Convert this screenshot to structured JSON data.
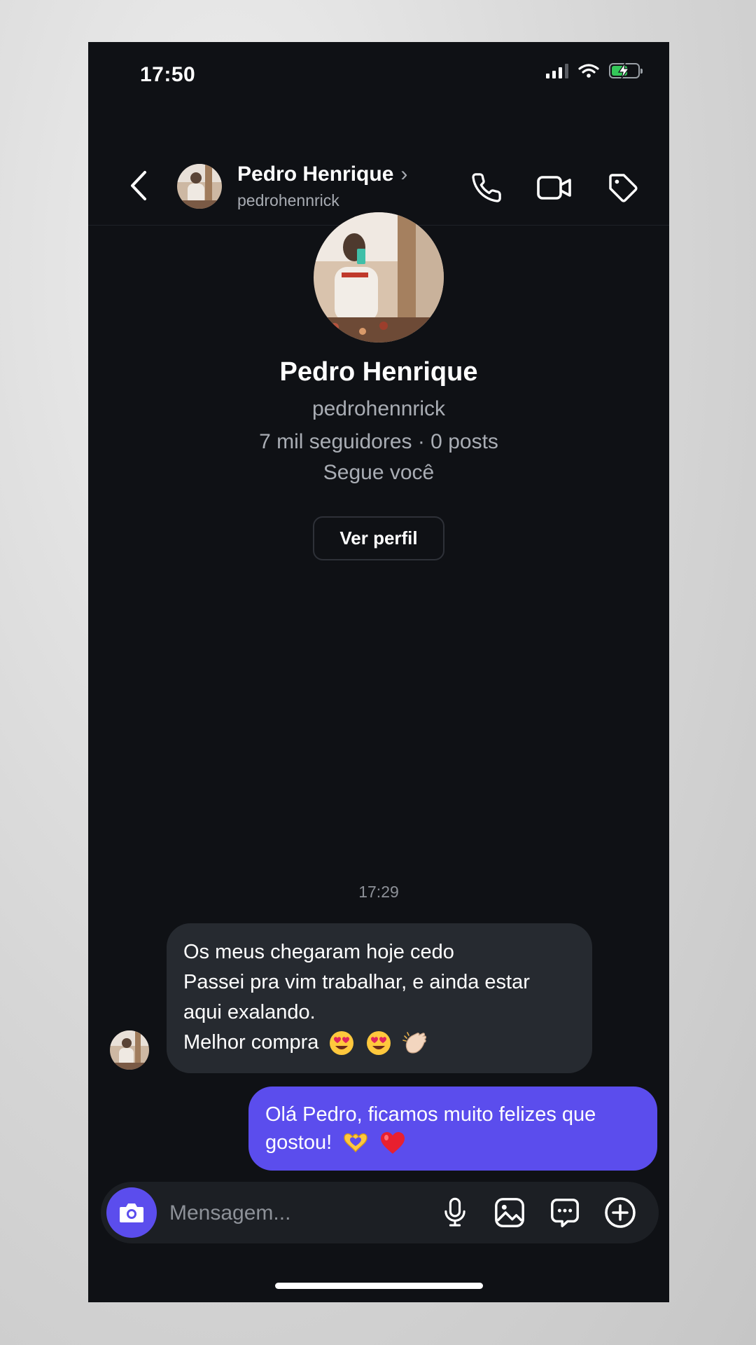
{
  "status_bar": {
    "time": "17:50"
  },
  "header": {
    "name": "Pedro Henrique",
    "chevron": "›",
    "handle": "pedrohennrick",
    "icons": [
      "back-icon",
      "phone-icon",
      "video-icon",
      "tag-icon"
    ]
  },
  "profile": {
    "name": "Pedro Henrique",
    "handle": "pedrohennrick",
    "stats": "7 mil seguidores · 0 posts",
    "follows_you": "Segue você",
    "view_profile_label": "Ver perfil"
  },
  "conversation": {
    "timestamp": "17:29",
    "incoming": {
      "lines": [
        "Os meus chegaram hoje cedo",
        "Passei pra vim trabalhar, e ainda estar",
        "aqui exalando.",
        "Melhor compra"
      ],
      "emojis": [
        "heart-eyes-emoji",
        "heart-eyes-emoji",
        "clapping-hands-emoji"
      ]
    },
    "outgoing": {
      "lines": [
        "Olá Pedro, ficamos muito felizes que",
        "gostou!"
      ],
      "emojis": [
        "heart-hands-emoji",
        "red-heart-emoji"
      ]
    }
  },
  "composer": {
    "placeholder": "Mensagem...",
    "icons": [
      "camera-icon",
      "microphone-icon",
      "gallery-icon",
      "sticker-icon",
      "plus-icon"
    ]
  },
  "colors": {
    "background": "#0f1115",
    "accent": "#5b4ded",
    "incoming_bubble": "#262a30",
    "composer": "#1c1f24"
  }
}
